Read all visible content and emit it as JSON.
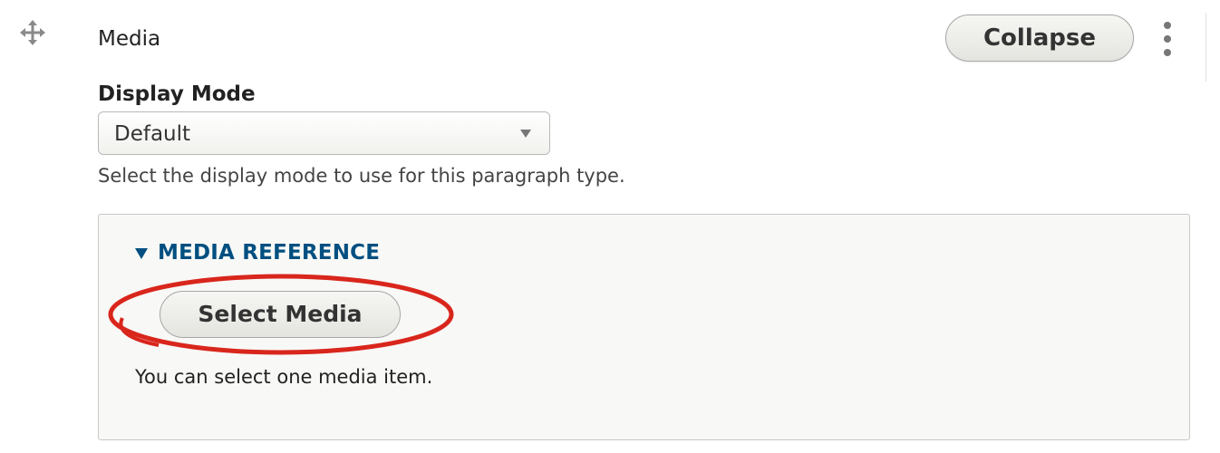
{
  "paragraph": {
    "label": "Media",
    "drag_icon": "move-arrows-icon",
    "collapse_label": "Collapse",
    "more_icon": "vertical-ellipsis-icon"
  },
  "display_mode": {
    "label": "Display Mode",
    "selected": "Default",
    "description": "Select the display mode to use for this paragraph type."
  },
  "media_reference": {
    "legend": "MEDIA REFERENCE",
    "legend_icon": "triangle-down-icon",
    "button_label": "Select Media",
    "description": "You can select one media item."
  },
  "colors": {
    "legend_blue": "#004f80",
    "highlight_red": "#d9261c",
    "fieldset_bg": "#f8f8f6"
  }
}
